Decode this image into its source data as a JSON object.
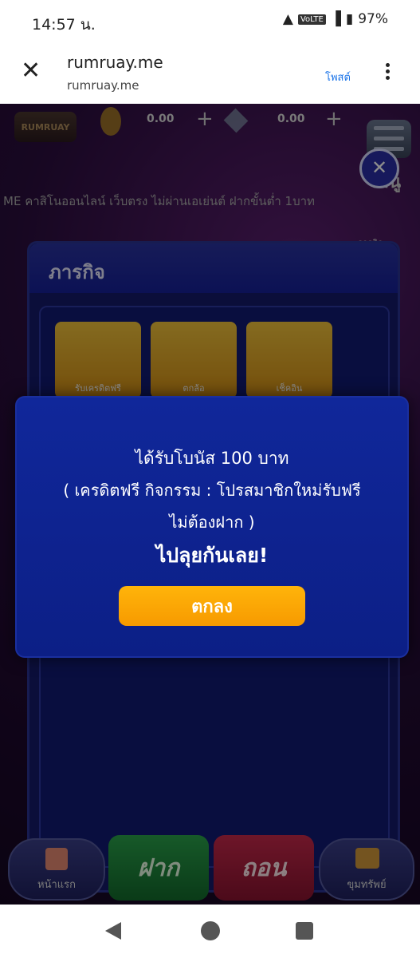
{
  "status_bar": {
    "time": "14:57 น.",
    "volte": "VoLTE",
    "battery": "97%"
  },
  "browser": {
    "title": "rumruay.me",
    "url": "rumruay.me",
    "post_label": "โพสต์"
  },
  "game": {
    "logo_text": "RUMRUAY",
    "balance_coin": "0.00",
    "balance_diamond": "0.00",
    "menu_label": "เมนู",
    "marquee": "ME คาสิโนออนไลน์ เว็บตรง ไม่ผ่านเอเย่นต์ ฝากขั้นต่ำ 1บาท",
    "mission_title": "ภารกิจ",
    "side_tag": "ภารกิจ",
    "cards": [
      "รับเครดิตฟรี",
      "ตกล้อ",
      "เช็คอิน"
    ]
  },
  "dialog": {
    "line1": "ได้รับโบนัส 100 บาท",
    "line2": "( เครดิตฟรี กิจกรรม : โปรสมาชิกใหม่รับฟรี",
    "line3": "ไม่ต้องฝาก )",
    "line4": "ไปลุยกันเลย!",
    "ok_label": "ตกลง"
  },
  "bottom_nav": {
    "home": "หน้าแรก",
    "deposit": "ฝาก",
    "withdraw": "ถอน",
    "treasure": "ขุมทรัพย์"
  },
  "colors": {
    "accent": "#ffb40a",
    "dialog_bg": "#10279a",
    "deposit": "#2aa34b",
    "withdraw": "#c8294b"
  }
}
